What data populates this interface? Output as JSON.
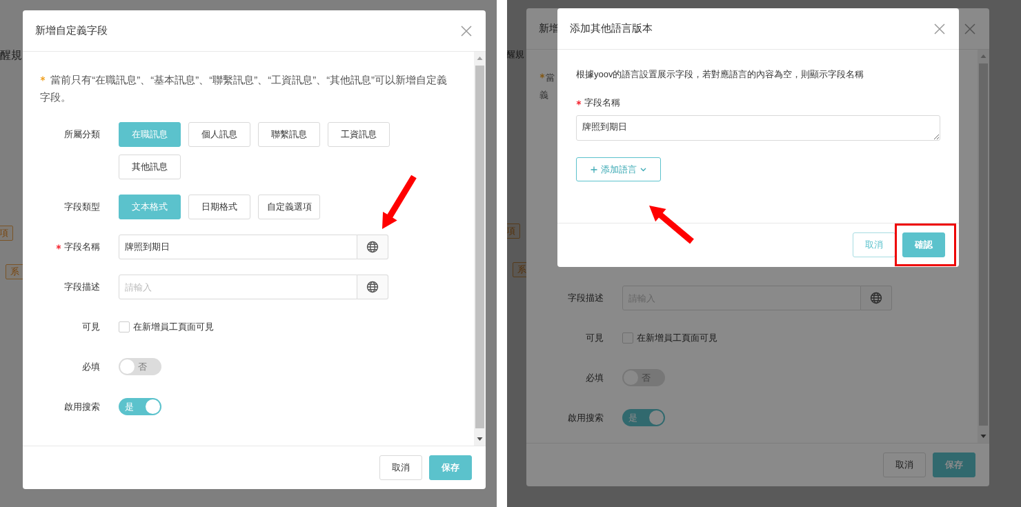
{
  "left": {
    "page_fragments": [
      {
        "kind": "text",
        "text": "醒規"
      },
      {
        "kind": "tag",
        "text": "項"
      },
      {
        "kind": "tag",
        "text": "系"
      }
    ],
    "dialog": {
      "title": "新增自定義字段",
      "notice": "當前只有“在職訊息”、“基本訊息”、“聯繫訊息”、“工資訊息”、“其他訊息”可以新增自定義字段。",
      "fields": [
        {
          "kind": "chips",
          "label": "所屬分類",
          "required": false,
          "options": [
            {
              "label": "在職訊息",
              "selected": true
            },
            {
              "label": "個人訊息",
              "selected": false
            },
            {
              "label": "聯繫訊息",
              "selected": false
            },
            {
              "label": "工資訊息",
              "selected": false
            },
            {
              "label": "其他訊息",
              "selected": false
            }
          ]
        },
        {
          "kind": "chips",
          "label": "字段類型",
          "required": false,
          "options": [
            {
              "label": "文本格式",
              "selected": true
            },
            {
              "label": "日期格式",
              "selected": false
            },
            {
              "label": "自定義選項",
              "selected": false
            }
          ]
        },
        {
          "kind": "input",
          "label": "字段名稱",
          "required": true,
          "value": "牌照到期日"
        },
        {
          "kind": "input",
          "label": "字段描述",
          "required": false,
          "placeholder": "請輸入"
        },
        {
          "kind": "checkbox",
          "label": "可見",
          "required": false,
          "text": "在新增員工頁面可見",
          "checked": false
        },
        {
          "kind": "switch",
          "label": "必填",
          "required": false,
          "text": "否",
          "on": false
        },
        {
          "kind": "switch",
          "label": "啟用搜索",
          "required": false,
          "text": "是",
          "on": true
        }
      ],
      "buttons": [
        {
          "label": "取消",
          "kind": "default"
        },
        {
          "label": "保存",
          "kind": "primary"
        }
      ]
    },
    "annotations": [
      {
        "kind": "arrow"
      }
    ]
  },
  "right": {
    "page_fragments": [
      {
        "kind": "text",
        "text": "醒規"
      },
      {
        "kind": "tag",
        "text": "項"
      },
      {
        "kind": "tag",
        "text": "系"
      }
    ],
    "under_dialog": {
      "title": "新增",
      "notice_fragments": [
        "當",
        "義"
      ],
      "fields": [
        {
          "kind": "input",
          "label": "字段描述",
          "required": false,
          "placeholder": "請輸入"
        },
        {
          "kind": "checkbox",
          "label": "可見",
          "required": false,
          "text": "在新增員工頁面可見",
          "checked": false
        },
        {
          "kind": "switch",
          "label": "必填",
          "required": false,
          "text": "否",
          "on": false
        },
        {
          "kind": "switch",
          "label": "啟用搜索",
          "required": false,
          "text": "是",
          "on": true
        }
      ],
      "buttons": [
        {
          "label": "取消",
          "kind": "default"
        },
        {
          "label": "保存",
          "kind": "primary"
        }
      ]
    },
    "dialog": {
      "title": "添加其他語言版本",
      "description": "根據yoov的語言設置展示字段，若對應語言的內容為空，則顯示字段名稱",
      "field_label": "字段名稱",
      "field_required": true,
      "field_value": "牌照到期日",
      "add_button": "添加語言",
      "buttons": [
        {
          "label": "取消",
          "kind": "default"
        },
        {
          "label": "確認",
          "kind": "primary"
        }
      ]
    },
    "annotations": [
      {
        "kind": "arrow"
      },
      {
        "kind": "frame"
      }
    ]
  }
}
